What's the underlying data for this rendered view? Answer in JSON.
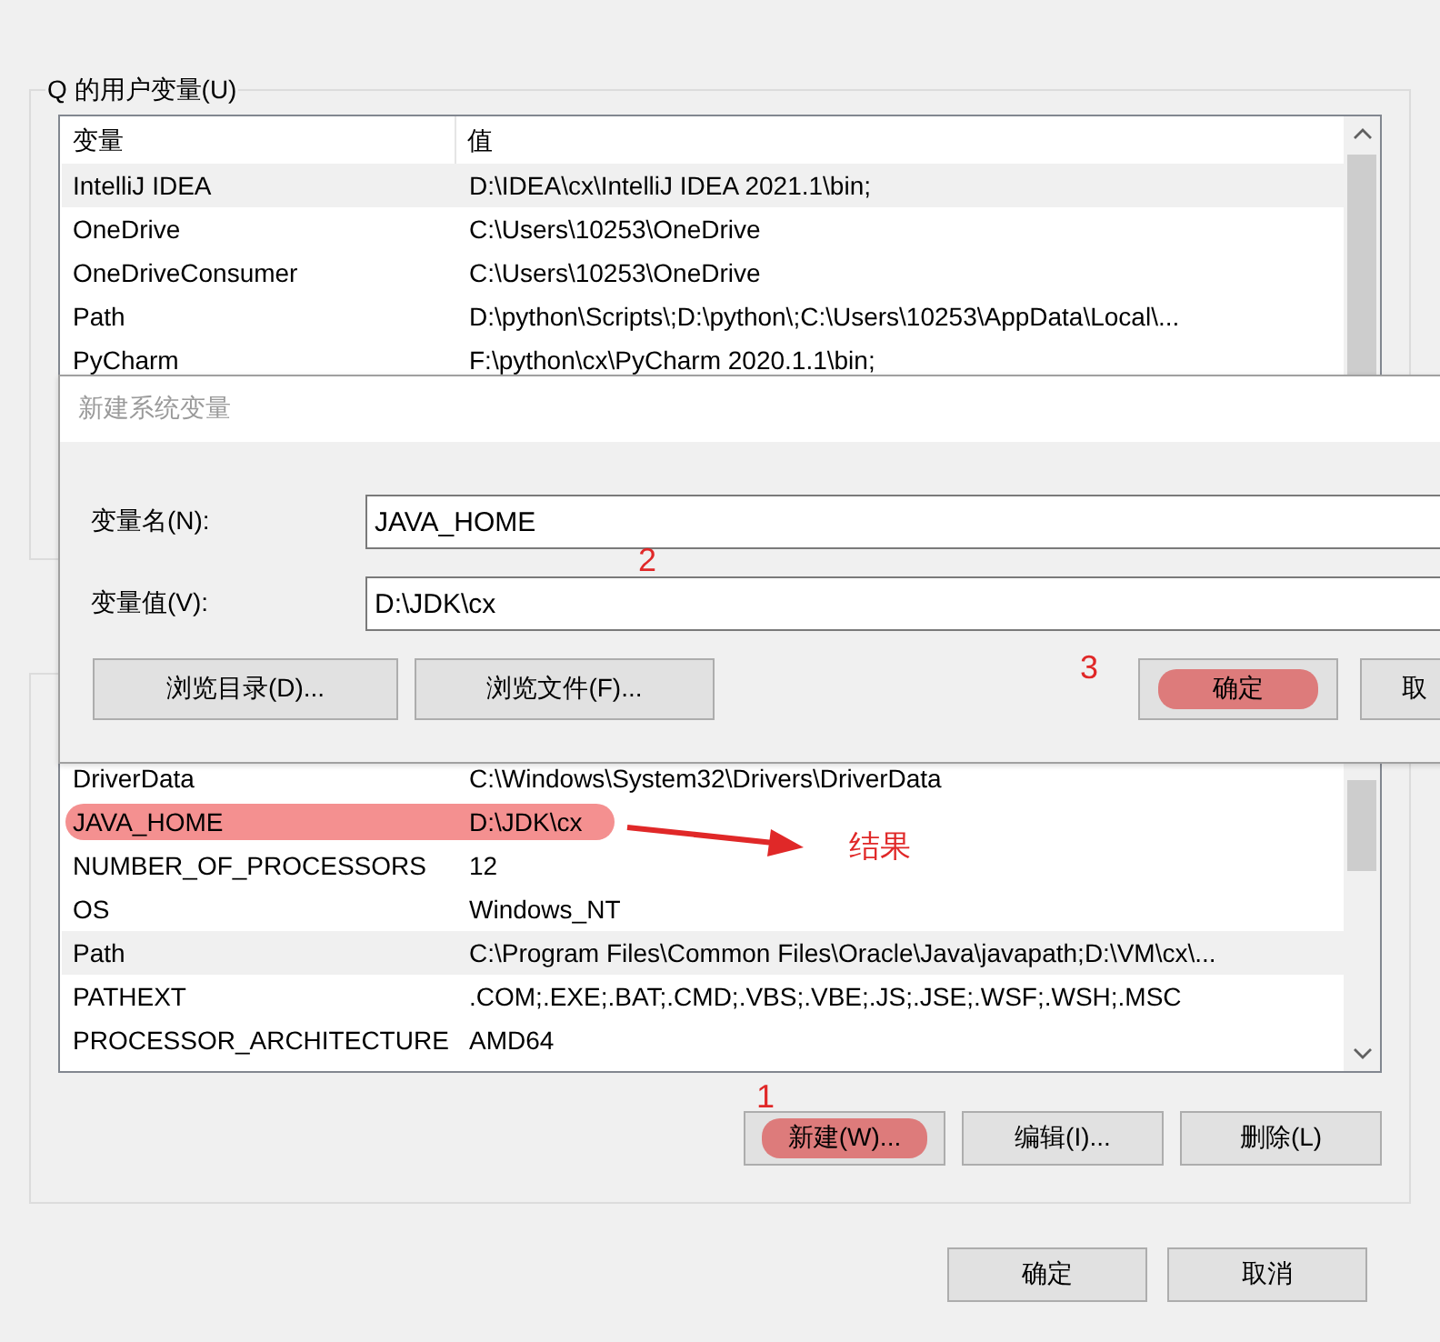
{
  "user_variables": {
    "title": "Q 的用户变量(U)",
    "columns": [
      "变量",
      "值"
    ],
    "rows": [
      {
        "name": "IntelliJ IDEA",
        "value": "D:\\IDEA\\cx\\IntelliJ IDEA 2021.1\\bin;",
        "selected": true,
        "highlighted": false
      },
      {
        "name": "OneDrive",
        "value": "C:\\Users\\10253\\OneDrive",
        "selected": false,
        "highlighted": false
      },
      {
        "name": "OneDriveConsumer",
        "value": "C:\\Users\\10253\\OneDrive",
        "selected": false,
        "highlighted": false
      },
      {
        "name": "Path",
        "value": "D:\\python\\Scripts\\;D:\\python\\;C:\\Users\\10253\\AppData\\Local\\...",
        "selected": false,
        "highlighted": false
      },
      {
        "name": "PyCharm",
        "value": "F:\\python\\cx\\PyCharm 2020.1.1\\bin;",
        "selected": false,
        "highlighted": false
      }
    ]
  },
  "system_variables": {
    "rows": [
      {
        "name": "DriverData",
        "value": "C:\\Windows\\System32\\Drivers\\DriverData",
        "selected": false,
        "highlighted": false
      },
      {
        "name": "JAVA_HOME",
        "value": "D:\\JDK\\cx",
        "selected": false,
        "highlighted": true
      },
      {
        "name": "NUMBER_OF_PROCESSORS",
        "value": "12",
        "selected": false,
        "highlighted": false
      },
      {
        "name": "OS",
        "value": "Windows_NT",
        "selected": false,
        "highlighted": false
      },
      {
        "name": "Path",
        "value": "C:\\Program Files\\Common Files\\Oracle\\Java\\javapath;D:\\VM\\cx\\...",
        "selected": true,
        "highlighted": false
      },
      {
        "name": "PATHEXT",
        "value": ".COM;.EXE;.BAT;.CMD;.VBS;.VBE;.JS;.JSE;.WSF;.WSH;.MSC",
        "selected": false,
        "highlighted": false
      },
      {
        "name": "PROCESSOR_ARCHITECTURE",
        "value": "AMD64",
        "selected": false,
        "highlighted": false
      }
    ],
    "buttons": [
      {
        "label": "新建(W)...",
        "highlighted": true
      },
      {
        "label": "编辑(I)...",
        "highlighted": false
      },
      {
        "label": "删除(L)",
        "highlighted": false
      }
    ]
  },
  "buttons": [
    {
      "label": "确定"
    },
    {
      "label": "取消"
    }
  ],
  "new_variable_dialog": {
    "title": "新建系统变量",
    "fields": [
      {
        "label": "变量名(N):",
        "value": "JAVA_HOME"
      },
      {
        "label": "变量值(V):",
        "value": "D:\\JDK\\cx"
      }
    ],
    "buttons": [
      {
        "label": "浏览目录(D)...",
        "highlighted": false
      },
      {
        "label": "浏览文件(F)...",
        "highlighted": false
      },
      {
        "label": "确定",
        "highlighted": true
      },
      {
        "label": "取",
        "highlighted": false
      }
    ]
  },
  "annotations": [
    {
      "kind": "number",
      "text": "1"
    },
    {
      "kind": "number",
      "text": "2"
    },
    {
      "kind": "number",
      "text": "3"
    },
    {
      "kind": "arrow"
    },
    {
      "kind": "label",
      "text": "结果"
    }
  ]
}
